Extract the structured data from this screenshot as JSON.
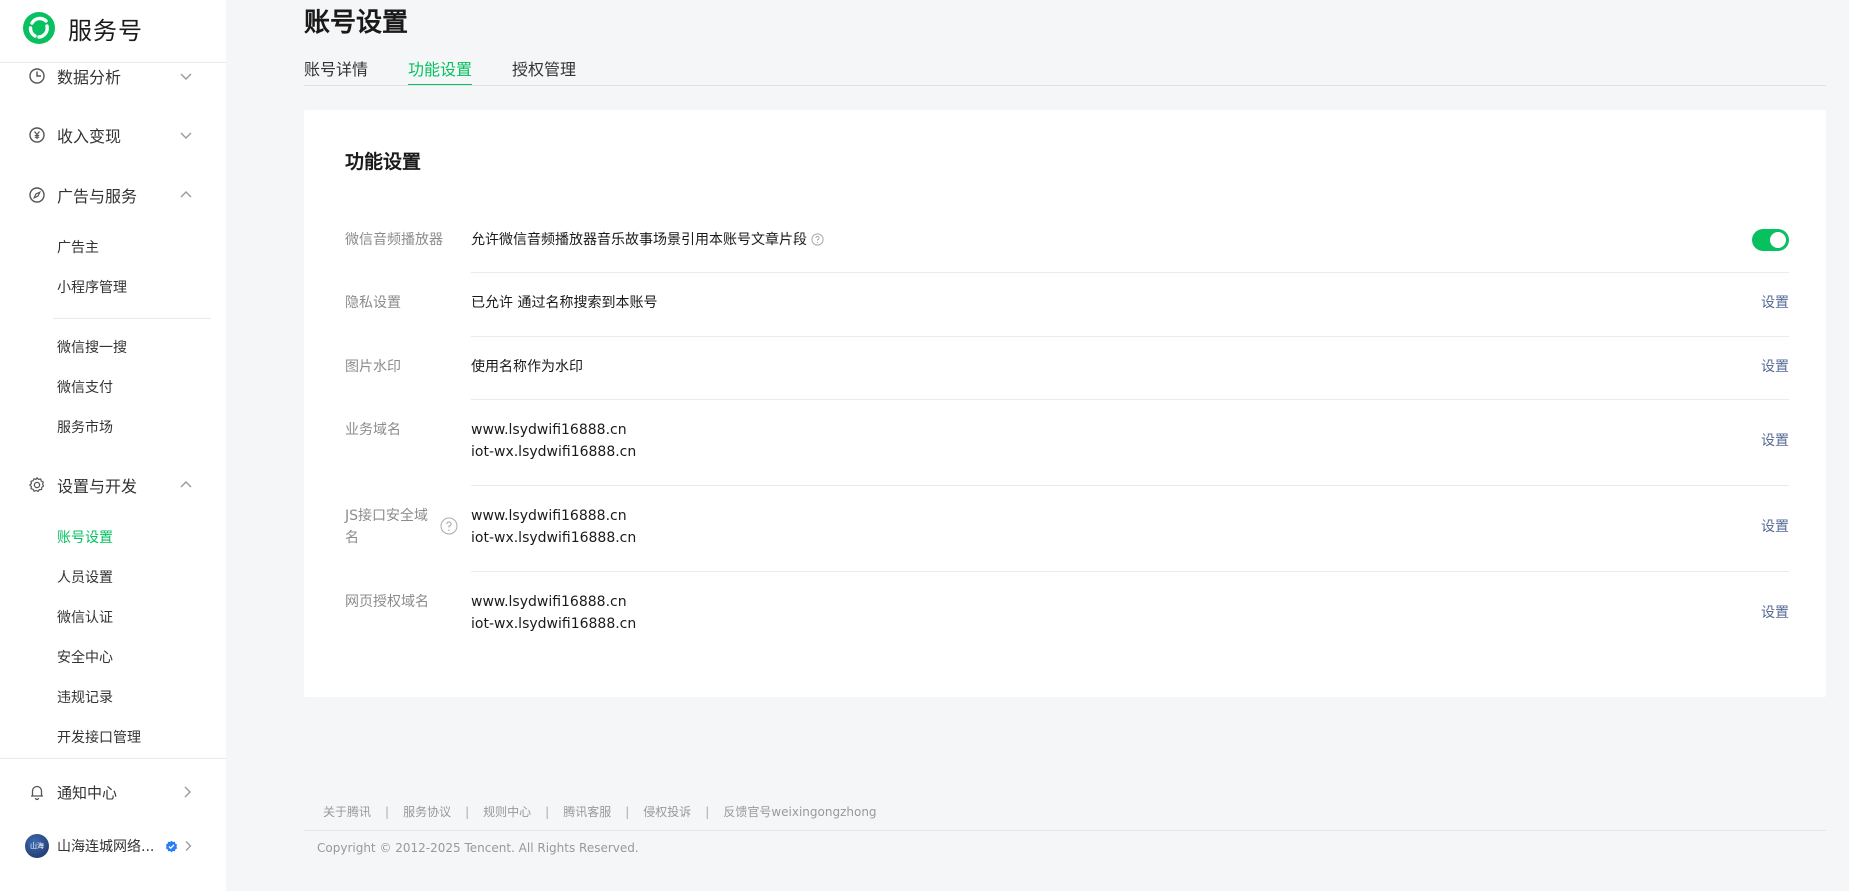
{
  "brand": {
    "name": "服务号",
    "accent": "#07c160"
  },
  "sidebar": {
    "groups": [
      {
        "label": "数据分析",
        "icon": "chart-pie-icon",
        "expanded": false
      },
      {
        "label": "收入变现",
        "icon": "yuan-coin-icon",
        "expanded": false
      },
      {
        "label": "广告与服务",
        "icon": "compass-icon",
        "expanded": true
      },
      {
        "label": "设置与开发",
        "icon": "gear-icon",
        "expanded": true
      }
    ],
    "ads_items": [
      "广告主",
      "小程序管理",
      "微信搜一搜",
      "微信支付",
      "服务市场"
    ],
    "settings_items": [
      "账号设置",
      "人员设置",
      "微信认证",
      "安全中心",
      "违规记录",
      "开发接口管理"
    ],
    "active_item": "账号设置",
    "notice": {
      "label": "通知中心",
      "icon": "bell-icon"
    },
    "account": {
      "name": "山海连城网络...",
      "avatar_text": "山海",
      "verified": true
    }
  },
  "page": {
    "title": "账号设置"
  },
  "tabs": [
    {
      "label": "账号详情",
      "active": false
    },
    {
      "label": "功能设置",
      "active": true
    },
    {
      "label": "授权管理",
      "active": false
    }
  ],
  "card": {
    "title": "功能设置",
    "rows": [
      {
        "label": "微信音频播放器",
        "value": "允许微信音频播放器音乐故事场景引用本账号文章片段",
        "toggle_on": true
      },
      {
        "label": "隐私设置",
        "value": "已允许 通过名称搜索到本账号",
        "action": "设置"
      },
      {
        "label": "图片水印",
        "value": "使用名称作为水印",
        "action": "设置"
      },
      {
        "label": "业务域名",
        "values": [
          "www.lsydwifi16888.cn",
          "iot-wx.lsydwifi16888.cn"
        ],
        "action": "设置"
      },
      {
        "label_lines": [
          "JS接口安全域",
          "名"
        ],
        "values": [
          "www.lsydwifi16888.cn",
          "iot-wx.lsydwifi16888.cn"
        ],
        "action": "设置"
      },
      {
        "label": "网页授权域名",
        "values": [
          "www.lsydwifi16888.cn",
          "iot-wx.lsydwifi16888.cn"
        ],
        "action": "设置"
      }
    ]
  },
  "footer": {
    "links": [
      "关于腾讯",
      "服务协议",
      "规则中心",
      "腾讯客服",
      "侵权投诉",
      "反馈官号weixingongzhong"
    ],
    "separator": "|",
    "copyright": "Copyright © 2012-2025 Tencent. All Rights Reserved."
  }
}
